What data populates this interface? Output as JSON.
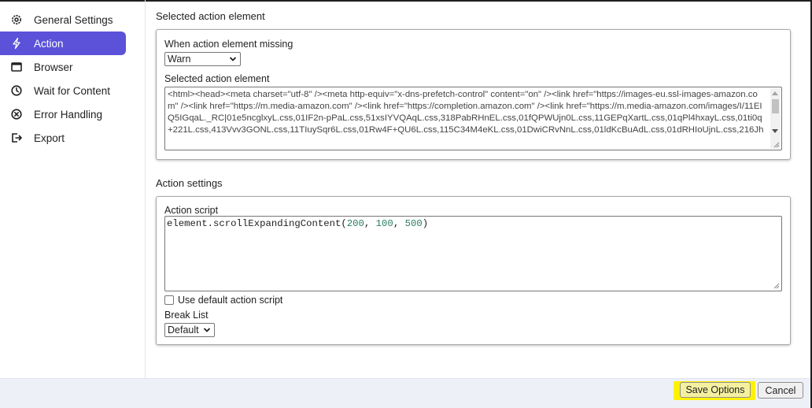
{
  "sidebar": {
    "items": [
      {
        "label": "General Settings",
        "icon": "gear-icon"
      },
      {
        "label": "Action",
        "icon": "lightning-icon",
        "active": true
      },
      {
        "label": "Browser",
        "icon": "browser-window-icon"
      },
      {
        "label": "Wait for Content",
        "icon": "clock-icon"
      },
      {
        "label": "Error Handling",
        "icon": "error-circle-icon"
      },
      {
        "label": "Export",
        "icon": "export-icon"
      }
    ]
  },
  "selected_action_section": {
    "title": "Selected action element",
    "missing_label": "When action element missing",
    "missing_value": "Warn",
    "element_label": "Selected action element",
    "element_html": "<html><head><meta charset=\"utf-8\" /><meta http-equiv=\"x-dns-prefetch-control\" content=\"on\" /><link href=\"https://images-eu.ssl-images-amazon.com\" /><link href=\"https://m.media-amazon.com\" /><link href=\"https://completion.amazon.com\" /><link href=\"https://m.media-amazon.com/images/I/11EIQ5IGqaL._RC|01e5ncglxyL.css,01IF2n-pPaL.css,51xsIYVQAqL.css,318PabRHnEL.css,01fQPWUjn0L.css,11GEPqXartL.css,01qPl4hxayL.css,01ti0q+221L.css,413Vvv3GONL.css,11TIuySqr6L.css,01Rw4F+QU6L.css,115C34M4eKL.css,01DwiCRvNnL.css,01ldKcBuAdL.css,01dRHIoUjnL.css,216Jh"
  },
  "action_settings_section": {
    "title": "Action settings",
    "script_label": "Action script",
    "script_call": "element.scrollExpandingContent(",
    "arg1": "200",
    "sep1": ", ",
    "arg2": "100",
    "sep2": ", ",
    "arg3": "500",
    "close": ")",
    "default_script_label": "Use default action script",
    "default_script_checked": false,
    "break_list_label": "Break List",
    "break_list_value": "Default"
  },
  "footer": {
    "save_label": "Save Options",
    "cancel_label": "Cancel",
    "highlight_color": "#fff200"
  },
  "colors": {
    "accent": "#5b52d9"
  }
}
